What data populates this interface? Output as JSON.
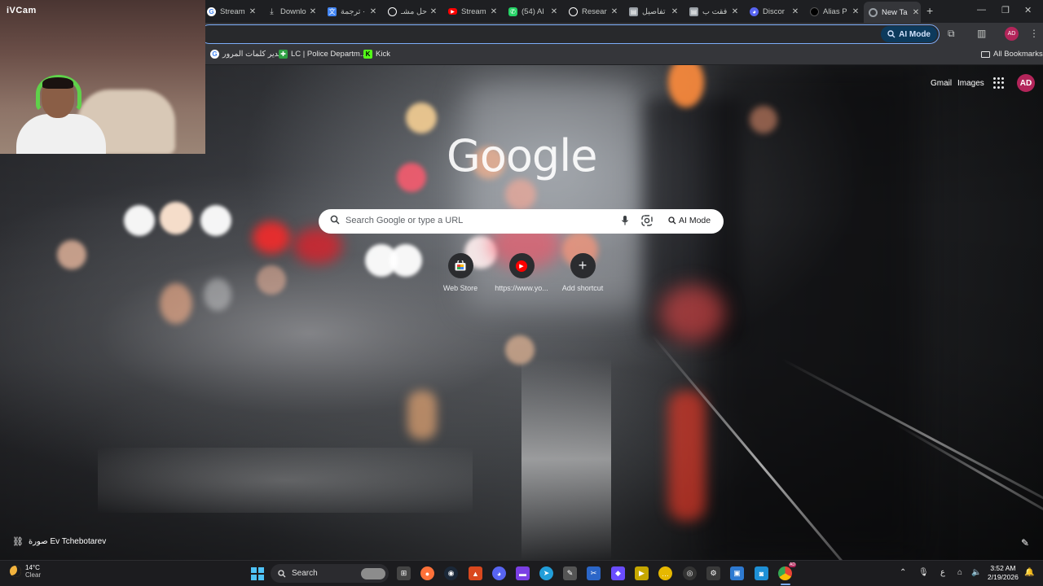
{
  "ivcam": {
    "title": "iVCam"
  },
  "tabs": [
    {
      "title": "Stream",
      "icon": "google-icon",
      "color": "#ffffff"
    },
    {
      "title": "Downlo",
      "icon": "download-icon",
      "color": "#c4c7c5"
    },
    {
      "title": "ترجمة ·",
      "icon": "translate-icon",
      "color": "#4285f4"
    },
    {
      "title": "حل مشـ",
      "icon": "chatgpt-icon",
      "color": "#ffffff"
    },
    {
      "title": "Stream",
      "icon": "youtube-icon",
      "color": "#ff0000"
    },
    {
      "title": "(54) Al",
      "icon": "whatsapp-icon",
      "color": "#25d366"
    },
    {
      "title": "Resear",
      "icon": "chatgpt-icon",
      "color": "#ffffff"
    },
    {
      "title": "تفاصيل",
      "icon": "doc-icon",
      "color": "#9aa0a6"
    },
    {
      "title": "فقت ب",
      "icon": "doc-icon",
      "color": "#9aa0a6"
    },
    {
      "title": "Discor",
      "icon": "discord-icon",
      "color": "#5865f2"
    },
    {
      "title": "Alias P",
      "icon": "github-icon",
      "color": "#000000"
    },
    {
      "title": "New Ta",
      "icon": "chrome-icon",
      "color": "#9aa0a6",
      "active": true
    }
  ],
  "toolbar": {
    "ai_mode_label": "AI Mode"
  },
  "bookmarks": {
    "items": [
      {
        "label": "مدير كلمات المرور",
        "icon": "google-icon",
        "color": "#4285f4"
      },
      {
        "label": "LC | Police Departm...",
        "icon": "lc-icon",
        "color": "#2ea043"
      },
      {
        "label": "Kick",
        "icon": "kick-icon",
        "color": "#53fc18"
      }
    ],
    "all_label": "All Bookmarks"
  },
  "ntp": {
    "gmail": "Gmail",
    "images": "Images",
    "avatar_initials": "AD",
    "logo": "Google",
    "search_placeholder": "Search Google or type a URL",
    "ai_mode": "AI Mode",
    "shortcuts": [
      {
        "label": "Web Store",
        "icon": "webstore-icon"
      },
      {
        "label": "https://www.yo...",
        "icon": "youtube-icon"
      },
      {
        "label": "Add shortcut",
        "icon": "plus-icon"
      }
    ],
    "photo_credit": "صورة Ev Tchebotarev"
  },
  "taskbar": {
    "weather_temp": "14°C",
    "weather_cond": "Clear",
    "search_label": "Search",
    "lang": "ع",
    "time": "3:52 AM",
    "date": "2/19/2026",
    "chrome_badge": "AD"
  }
}
